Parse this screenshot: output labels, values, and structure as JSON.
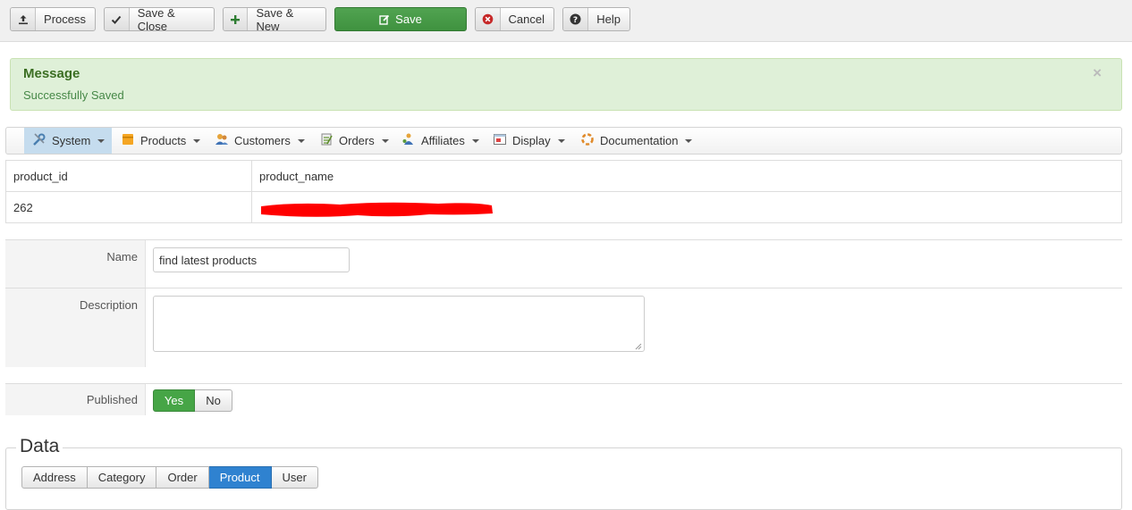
{
  "toolbar": {
    "buttons": [
      {
        "label": "Process",
        "icon": "upload-icon"
      },
      {
        "label": "Save & Close",
        "icon": "check-icon"
      },
      {
        "label": "Save & New",
        "icon": "plus-icon"
      },
      {
        "label": "Save",
        "icon": "edit-icon"
      },
      {
        "label": "Cancel",
        "icon": "cancel-circle-icon"
      },
      {
        "label": "Help",
        "icon": "question-icon"
      }
    ]
  },
  "message": {
    "heading": "Message",
    "text": "Successfully Saved",
    "close": "×"
  },
  "menu": {
    "items": [
      {
        "label": "System",
        "icon": "wrench-icon",
        "active": true
      },
      {
        "label": "Products",
        "icon": "box-icon"
      },
      {
        "label": "Customers",
        "icon": "users-icon"
      },
      {
        "label": "Orders",
        "icon": "clipboard-icon"
      },
      {
        "label": "Affiliates",
        "icon": "affiliates-icon"
      },
      {
        "label": "Display",
        "icon": "window-icon"
      },
      {
        "label": "Documentation",
        "icon": "lifebuoy-icon"
      }
    ]
  },
  "table": {
    "headers": [
      "product_id",
      "product_name"
    ],
    "rows": [
      [
        "262",
        ""
      ]
    ]
  },
  "form": {
    "name_label": "Name",
    "name_value": "find latest products",
    "description_label": "Description",
    "description_value": "",
    "published_label": "Published",
    "yes_label": "Yes",
    "no_label": "No"
  },
  "data_section": {
    "legend": "Data",
    "tabs": [
      {
        "label": "Address"
      },
      {
        "label": "Category"
      },
      {
        "label": "Order"
      },
      {
        "label": "Product",
        "active": true
      },
      {
        "label": "User"
      }
    ]
  },
  "colors": {
    "success_green": "#46a546",
    "message_bg": "#dff0d8",
    "active_tab_blue": "#2f82d0",
    "menu_active_bg": "#c5dcee",
    "redaction_red": "#ff0000"
  }
}
